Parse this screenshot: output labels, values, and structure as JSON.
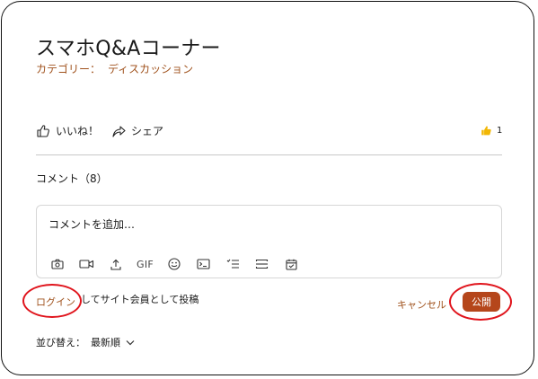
{
  "post": {
    "title": "スマホQ&Aコーナー",
    "category_label": "カテゴリー：",
    "category_value": "ディスカッション"
  },
  "actions": {
    "like_label": "いいね！",
    "share_label": "シェア",
    "like_count": "1"
  },
  "comments": {
    "heading": "コメント（8）",
    "placeholder": "コメントを追加…",
    "toolbar_gif": "GIF",
    "toolbar_icons": [
      "camera-icon",
      "video-icon",
      "upload-icon",
      "gif-icon",
      "emoji-icon",
      "code-icon",
      "checklist-icon",
      "divider-icon",
      "calendar-icon"
    ]
  },
  "posting": {
    "login_label": "ログイン",
    "post_as_text": "してサイト会員として投稿",
    "cancel_label": "キャンセル",
    "publish_label": "公開"
  },
  "sort": {
    "label": "並び替え：",
    "value": "最新順"
  },
  "annotations": {
    "ring_color": "#e0141c"
  },
  "colors": {
    "accent": "#a0521d",
    "publish_bg": "#b5461b"
  }
}
